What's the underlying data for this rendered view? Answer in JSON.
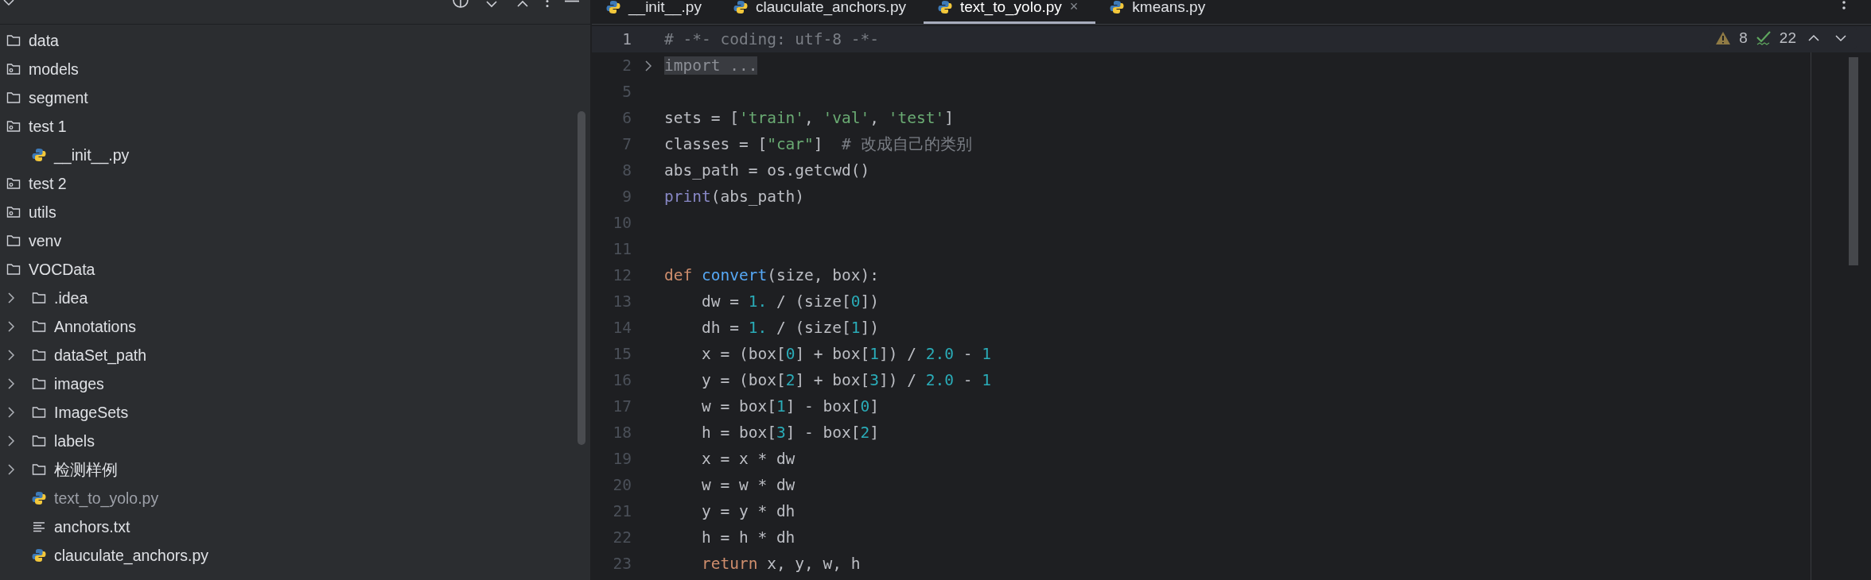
{
  "project_tree": {
    "items": [
      {
        "kind": "folder",
        "label": "data",
        "dimmed": false
      },
      {
        "kind": "module",
        "label": "models",
        "dimmed": false
      },
      {
        "kind": "folder",
        "label": "segment",
        "dimmed": false
      },
      {
        "kind": "module",
        "label": "test 1",
        "dimmed": false,
        "children": [
          {
            "kind": "python",
            "label": "__init__.py",
            "dimmed": false
          }
        ]
      },
      {
        "kind": "module",
        "label": "test 2",
        "dimmed": false
      },
      {
        "kind": "module",
        "label": "utils",
        "dimmed": false
      },
      {
        "kind": "folder",
        "label": "venv",
        "dimmed": false
      },
      {
        "kind": "folder",
        "label": "VOCData",
        "dimmed": false,
        "children": [
          {
            "kind": "folder",
            "label": ".idea",
            "expanded": false,
            "dimmed": false
          },
          {
            "kind": "folder",
            "label": "Annotations",
            "expanded": false,
            "dimmed": false
          },
          {
            "kind": "folder",
            "label": "dataSet_path",
            "expanded": false,
            "dimmed": false
          },
          {
            "kind": "folder",
            "label": "images",
            "expanded": false,
            "dimmed": false
          },
          {
            "kind": "folder",
            "label": "ImageSets",
            "expanded": false,
            "dimmed": false
          },
          {
            "kind": "folder",
            "label": "labels",
            "expanded": false,
            "dimmed": false
          },
          {
            "kind": "folder",
            "label": "检测样例",
            "expanded": false,
            "dimmed": false
          },
          {
            "kind": "python",
            "label": "text_to_yolo.py",
            "dimmed": true
          },
          {
            "kind": "text",
            "label": "anchors.txt",
            "dimmed": false
          },
          {
            "kind": "python",
            "label": "clauculate_anchors.py",
            "dimmed": false
          }
        ]
      }
    ]
  },
  "tabs": [
    {
      "label": "__init__.py",
      "selected": false
    },
    {
      "label": "clauculate_anchors.py",
      "selected": false
    },
    {
      "label": "text_to_yolo.py",
      "selected": true,
      "close": "×"
    },
    {
      "label": "kmeans.py",
      "selected": false
    }
  ],
  "inspections": {
    "warnings": "8",
    "weak_warnings": "22"
  },
  "code_lines": [
    {
      "number": "1",
      "current": true,
      "fold": false,
      "tokens": [
        {
          "kind": "comment",
          "text": "# -*- coding: utf-8 -*-"
        }
      ]
    },
    {
      "number": "2",
      "current": false,
      "fold": true,
      "tokens": [
        {
          "kind": "folded",
          "text": "import ..."
        }
      ]
    },
    {
      "number": "5",
      "current": false,
      "fold": false
    },
    {
      "number": "6",
      "current": false,
      "fold": false,
      "tokens": [
        {
          "kind": "plain",
          "text": "sets = ["
        },
        {
          "kind": "string",
          "text": "'train'"
        },
        {
          "kind": "plain",
          "text": ", "
        },
        {
          "kind": "string",
          "text": "'val'"
        },
        {
          "kind": "plain",
          "text": ", "
        },
        {
          "kind": "string",
          "text": "'test'"
        },
        {
          "kind": "plain",
          "text": "]"
        }
      ]
    },
    {
      "number": "7",
      "current": false,
      "fold": false,
      "tokens": [
        {
          "kind": "plain",
          "text": "classes = ["
        },
        {
          "kind": "string",
          "text": "\"car\""
        },
        {
          "kind": "plain",
          "text": "]  "
        },
        {
          "kind": "comment",
          "text": "# 改成自己的类别"
        }
      ]
    },
    {
      "number": "8",
      "current": false,
      "fold": false,
      "tokens": [
        {
          "kind": "plain",
          "text": "abs_path = os.getcwd()"
        }
      ]
    },
    {
      "number": "9",
      "current": false,
      "fold": false,
      "tokens": [
        {
          "kind": "builtin",
          "text": "print"
        },
        {
          "kind": "plain",
          "text": "(abs_path)"
        }
      ]
    },
    {
      "number": "10",
      "current": false,
      "fold": false
    },
    {
      "number": "11",
      "current": false,
      "fold": false
    },
    {
      "number": "12",
      "current": false,
      "fold": false,
      "tokens": [
        {
          "kind": "keyword",
          "text": "def "
        },
        {
          "kind": "function",
          "text": "convert"
        },
        {
          "kind": "plain",
          "text": "(size, box):"
        }
      ]
    },
    {
      "number": "13",
      "current": false,
      "fold": false,
      "tokens": [
        {
          "kind": "plain",
          "text": "    dw = "
        },
        {
          "kind": "number",
          "text": "1."
        },
        {
          "kind": "plain",
          "text": " / (size["
        },
        {
          "kind": "number",
          "text": "0"
        },
        {
          "kind": "plain",
          "text": "])"
        }
      ]
    },
    {
      "number": "14",
      "current": false,
      "fold": false,
      "tokens": [
        {
          "kind": "plain",
          "text": "    dh = "
        },
        {
          "kind": "number",
          "text": "1."
        },
        {
          "kind": "plain",
          "text": " / (size["
        },
        {
          "kind": "number",
          "text": "1"
        },
        {
          "kind": "plain",
          "text": "])"
        }
      ]
    },
    {
      "number": "15",
      "current": false,
      "fold": false,
      "tokens": [
        {
          "kind": "plain",
          "text": "    x = (box["
        },
        {
          "kind": "number",
          "text": "0"
        },
        {
          "kind": "plain",
          "text": "] + box["
        },
        {
          "kind": "number",
          "text": "1"
        },
        {
          "kind": "plain",
          "text": "]) / "
        },
        {
          "kind": "number",
          "text": "2.0"
        },
        {
          "kind": "plain",
          "text": " - "
        },
        {
          "kind": "number",
          "text": "1"
        }
      ]
    },
    {
      "number": "16",
      "current": false,
      "fold": false,
      "tokens": [
        {
          "kind": "plain",
          "text": "    y = (box["
        },
        {
          "kind": "number",
          "text": "2"
        },
        {
          "kind": "plain",
          "text": "] + box["
        },
        {
          "kind": "number",
          "text": "3"
        },
        {
          "kind": "plain",
          "text": "]) / "
        },
        {
          "kind": "number",
          "text": "2.0"
        },
        {
          "kind": "plain",
          "text": " - "
        },
        {
          "kind": "number",
          "text": "1"
        }
      ]
    },
    {
      "number": "17",
      "current": false,
      "fold": false,
      "tokens": [
        {
          "kind": "plain",
          "text": "    w = box["
        },
        {
          "kind": "number",
          "text": "1"
        },
        {
          "kind": "plain",
          "text": "] - box["
        },
        {
          "kind": "number",
          "text": "0"
        },
        {
          "kind": "plain",
          "text": "]"
        }
      ]
    },
    {
      "number": "18",
      "current": false,
      "fold": false,
      "tokens": [
        {
          "kind": "plain",
          "text": "    h = box["
        },
        {
          "kind": "number",
          "text": "3"
        },
        {
          "kind": "plain",
          "text": "] - box["
        },
        {
          "kind": "number",
          "text": "2"
        },
        {
          "kind": "plain",
          "text": "]"
        }
      ]
    },
    {
      "number": "19",
      "current": false,
      "fold": false,
      "tokens": [
        {
          "kind": "plain",
          "text": "    x = x * dw"
        }
      ]
    },
    {
      "number": "20",
      "current": false,
      "fold": false,
      "tokens": [
        {
          "kind": "plain",
          "text": "    w = w * dw"
        }
      ]
    },
    {
      "number": "21",
      "current": false,
      "fold": false,
      "tokens": [
        {
          "kind": "plain",
          "text": "    y = y * dh"
        }
      ]
    },
    {
      "number": "22",
      "current": false,
      "fold": false,
      "tokens": [
        {
          "kind": "plain",
          "text": "    h = h * dh"
        }
      ]
    },
    {
      "number": "23",
      "current": false,
      "fold": false,
      "tokens": [
        {
          "kind": "keyword",
          "text": "    return"
        },
        {
          "kind": "plain",
          "text": " x, y, w, h"
        }
      ]
    }
  ]
}
